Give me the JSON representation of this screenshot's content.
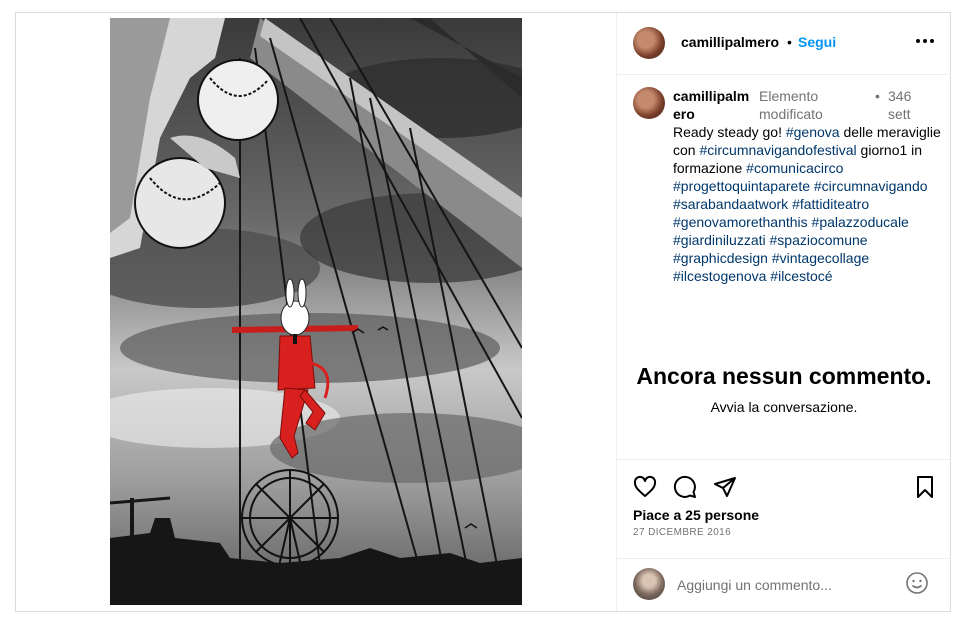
{
  "post": {
    "image_alt": "Collage: giocoliere con palline, coniglio bianco in abito rosso, ruota panoramica",
    "author": {
      "username": "camillipalmero",
      "follow_label": "Segui",
      "dot": "•",
      "more_icon": "more-horizontal-icon"
    },
    "caption": {
      "username": "camillipalmero",
      "edited_label": "Elemento modificato",
      "dot": "•",
      "age": "346 sett",
      "text_intro": "Ready steady go! ",
      "segments": [
        {
          "tag": "#genova"
        },
        {
          "text": " delle meraviglie con "
        },
        {
          "tag": "#circumnavigandofestival"
        },
        {
          "text": " giorno1 in formazione "
        },
        {
          "tag": "#comunicacirco"
        },
        {
          "text": " "
        },
        {
          "tag": "#progettoquintaparete"
        },
        {
          "text": " "
        },
        {
          "tag": "#circumnavigando"
        },
        {
          "text": " "
        },
        {
          "tag": "#sarabandaatwork"
        },
        {
          "text": " "
        },
        {
          "tag": "#fattiditeatro"
        },
        {
          "text": " "
        },
        {
          "tag": "#genovamorethanthis"
        },
        {
          "text": " "
        },
        {
          "tag": "#palazzoducale"
        },
        {
          "text": " "
        },
        {
          "tag": "#giardiniluzzati"
        },
        {
          "text": " "
        },
        {
          "tag": "#spaziocomune"
        },
        {
          "text": " "
        },
        {
          "tag": "#graphicdesign"
        },
        {
          "text": " "
        },
        {
          "tag": "#vintagecollage"
        },
        {
          "text": " "
        },
        {
          "tag": "#ilcestogenova"
        },
        {
          "text": " "
        },
        {
          "tag": "#ilcestocé"
        }
      ]
    },
    "comments": {
      "empty_title": "Ancora nessun commento.",
      "empty_subtitle": "Avvia la conversazione."
    },
    "actions": {
      "like_icon": "heart-icon",
      "comment_icon": "comment-icon",
      "share_icon": "send-icon",
      "save_icon": "bookmark-icon",
      "likes_text": "Piace a 25 persone",
      "date": "27 DICEMBRE 2016"
    },
    "comment_input": {
      "placeholder": "Aggiungi un commento...",
      "emoji_icon": "emoji-icon"
    },
    "colors": {
      "link": "#00376b",
      "follow": "#0095f6",
      "muted": "#737373",
      "border": "#dbdbdb",
      "accent_red": "#d8211e"
    }
  }
}
